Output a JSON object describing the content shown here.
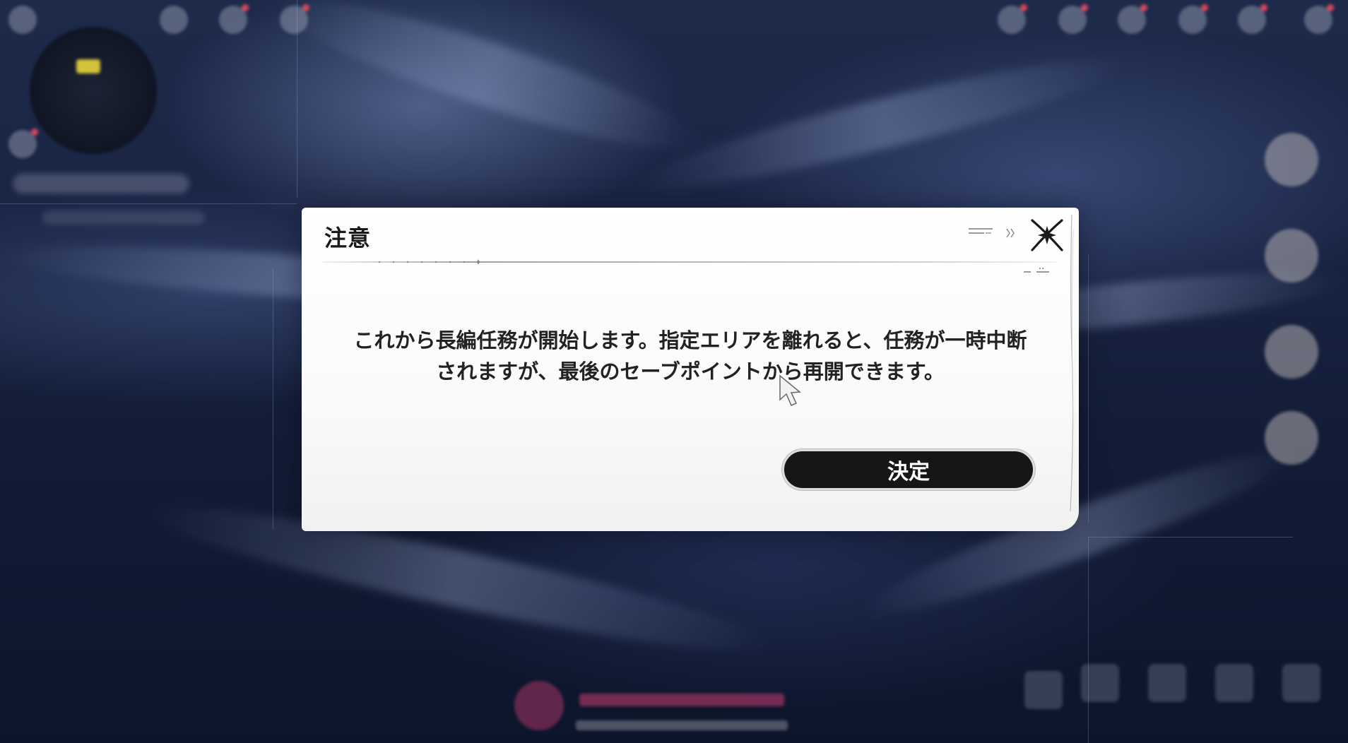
{
  "dialog": {
    "title": "注意",
    "message_line1": "これから長編任務が開始します。指定エリアを離れると、任務が一時中断",
    "message_line2": "されますが、最後のセーブポイントから再開できます。",
    "confirm_label": "決定",
    "close_icon": "close-x-icon"
  },
  "colors": {
    "dialog_bg": "#ffffff",
    "button_bg": "#161616",
    "button_text": "#ffffff",
    "title_text": "#1b1b1b",
    "health_bar": "#c83c6e"
  }
}
